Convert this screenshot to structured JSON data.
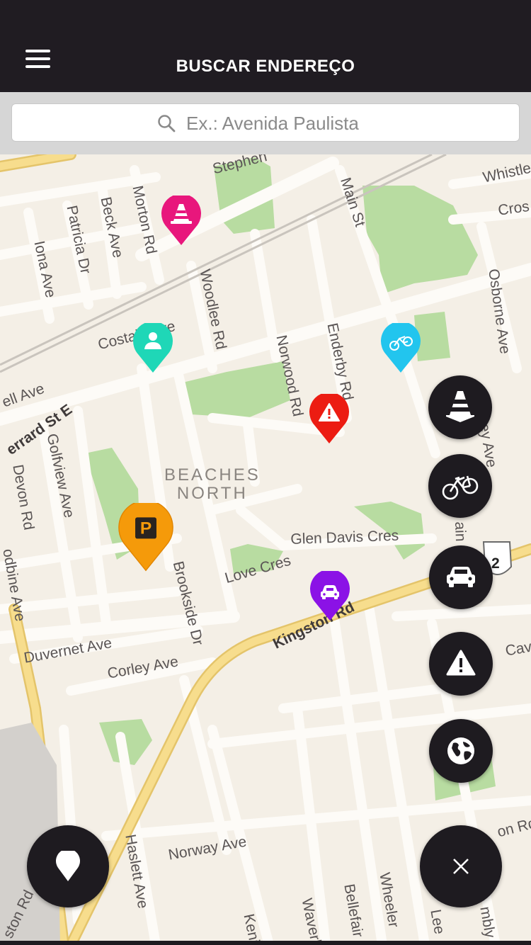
{
  "header": {
    "title": "BUSCAR ENDEREÇO",
    "menu_icon": "hamburger-menu-icon"
  },
  "search": {
    "placeholder": "Ex.: Avenida Paulista",
    "value": ""
  },
  "map": {
    "area_label": "BEACHES\nNORTH",
    "streets": {
      "stephen": "Stephen",
      "whistler": "Whistle",
      "cross": "Cros",
      "main": "Main St",
      "morton": "Morton Rd",
      "beck": "Beck Ave",
      "patricia": "Patricia Dr",
      "iona": "Iona Ave",
      "woodlee": "Woodlee Rd",
      "norwood": "Norwood Rd",
      "enderby": "Enderby Rd",
      "osborne": "Osborne Ave",
      "costain": "Costain Ave",
      "gerrard": "errard St E",
      "ell": "ell Ave",
      "golfview": "Golfview Ave",
      "devon": "Devon Rd",
      "brookside": "Brookside Dr",
      "glendavis": "Glen Davis Cres",
      "love": "Love Cres",
      "kingston": "Kingston Rd",
      "duvernet": "Duvernet Ave",
      "corley": "Corley Ave",
      "woodbine": "odbine Ave",
      "norway": "Norway Ave",
      "haslett": "Haslett Ave",
      "kenil": "Kenil",
      "waverley": "Waverl",
      "bellefair": "Bellefair",
      "wheeler": "Wheeler",
      "main2": "ain",
      "cavenc": "Caven",
      "ey": "ey Ave",
      "lee": "Lee",
      "mbly": "mbly",
      "ston": "ston Rd",
      "onrd": "on Rd",
      "shield": "2"
    }
  },
  "pins": [
    {
      "name": "construction-pin",
      "icon": "traffic-cone-icon",
      "color": "#e8177c"
    },
    {
      "name": "pedestrian-pin",
      "icon": "person-icon",
      "color": "#1fd7b7"
    },
    {
      "name": "bicycle-pin",
      "icon": "bicycle-icon",
      "color": "#22c5ee"
    },
    {
      "name": "alert-pin",
      "icon": "warning-icon",
      "color": "#ec1c12"
    },
    {
      "name": "parking-pin",
      "icon": "parking-icon",
      "color": "#f59a0a",
      "label": "P"
    },
    {
      "name": "car-pin",
      "icon": "car-icon",
      "color": "#8b12e6"
    }
  ],
  "fabs": [
    {
      "name": "filter-construction-button",
      "icon": "traffic-cone-icon"
    },
    {
      "name": "filter-bicycle-button",
      "icon": "bicycle-icon"
    },
    {
      "name": "filter-car-button",
      "icon": "car-icon"
    },
    {
      "name": "filter-alert-button",
      "icon": "warning-icon"
    },
    {
      "name": "filter-globe-button",
      "icon": "globe-icon"
    },
    {
      "name": "close-button",
      "icon": "close-icon"
    },
    {
      "name": "location-button",
      "icon": "location-pin-icon"
    }
  ],
  "colors": {
    "header_bg": "#201c22",
    "map_bg": "#f4efe6",
    "park": "#b8dca1",
    "road_major": "#f6d986",
    "fab_bg": "#1e1b20"
  }
}
